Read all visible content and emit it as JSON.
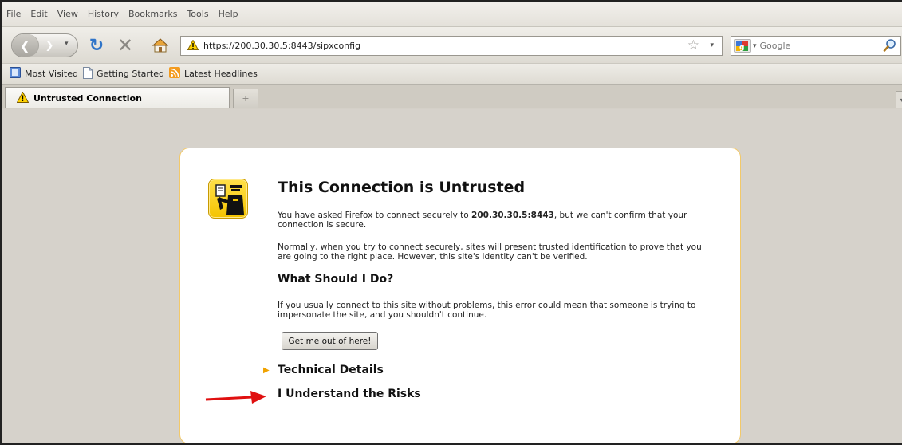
{
  "menu": {
    "items": [
      "File",
      "Edit",
      "View",
      "History",
      "Bookmarks",
      "Tools",
      "Help"
    ],
    "underline_letters": [
      "F",
      "E",
      "V",
      "s",
      "B",
      "T",
      "H"
    ]
  },
  "nav": {
    "url": "https://200.30.30.5:8443/sipxconfig",
    "search_placeholder": "Google",
    "google_logo_letter": "g"
  },
  "bookmarks": {
    "items": [
      {
        "label": "Most Visited",
        "icon": "most-visited-icon"
      },
      {
        "label": "Getting Started",
        "icon": "page-icon"
      },
      {
        "label": "Latest Headlines",
        "icon": "rss-icon"
      }
    ]
  },
  "tabs": {
    "active_label": "Untrusted Connection",
    "new_tab_symbol": "+"
  },
  "page": {
    "title": "This Connection is Untrusted",
    "p1_before": "You have asked Firefox to connect securely to ",
    "p1_host": "200.30.30.5:8443",
    "p1_after": ", but we can't confirm that your connection is secure.",
    "p2": "Normally, when you try to connect securely, sites will present trusted identification to prove that you are going to the right place. However, this site's identity can't be verified.",
    "subtitle": "What Should I Do?",
    "p3": "If you usually connect to this site without problems, this error could mean that someone is trying to impersonate the site, and you shouldn't continue.",
    "escape_button": "Get me out of here!",
    "technical_details": "Technical Details",
    "understand_risks": "I Understand the Risks"
  },
  "colors": {
    "panel_border": "#f2c96a",
    "warning_yellow": "#f4c400",
    "annotation_arrow": "#e01010",
    "content_bg": "#d6d2cb"
  }
}
